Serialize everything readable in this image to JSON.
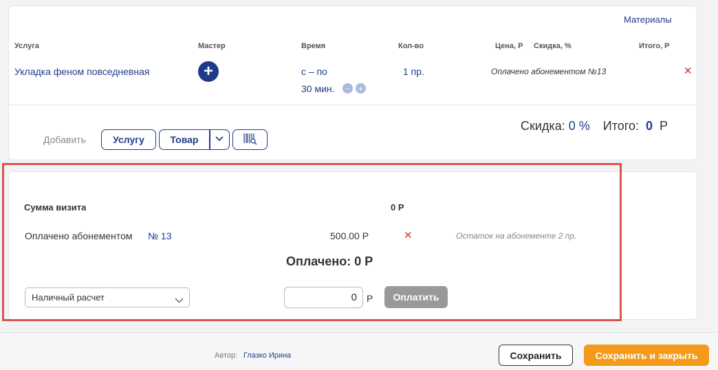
{
  "services": {
    "materials_link": "Материалы",
    "headers": {
      "service": "Услуга",
      "master": "Мастер",
      "time": "Время",
      "qty": "Кол-во",
      "price": "Цена, Р",
      "discount": "Скидка, %",
      "total": "Итого, Р"
    },
    "row": {
      "service": "Укладка феном повседневная",
      "time_line1": "с – по",
      "time_line2": "30 мин.",
      "qty": "1 пр.",
      "paid_note": "Оплачено абонементом №13"
    },
    "add_label": "Добавить",
    "add_service_button": "Услугу",
    "add_product_button": "Товар",
    "discount_label": "Скидка:",
    "discount_value": "0 %",
    "total_label": "Итого:",
    "total_value": "0",
    "currency": "Р"
  },
  "payment": {
    "visit_sum_label": "Сумма визита",
    "visit_sum_value": "0 Р",
    "subscription_label": "Оплачено абонементом",
    "subscription_number": "№ 13",
    "subscription_amount": "500.00 Р",
    "subscription_remainder": "Остаток на абонементе 2 пр.",
    "paid_total": "Оплачено: 0 Р",
    "payment_method": "Наличный расчет",
    "amount_value": "0",
    "currency": "Р",
    "pay_button": "Оплатить"
  },
  "footer": {
    "author_label": "Автор:",
    "author_name": "Глазко Ирина",
    "save_button": "Сохранить",
    "save_close_button": "Сохранить и закрыть"
  },
  "colors": {
    "accent": "#1f3a8a",
    "orange": "#f39a1a",
    "highlight": "#d9534f",
    "delete": "#e03030"
  }
}
